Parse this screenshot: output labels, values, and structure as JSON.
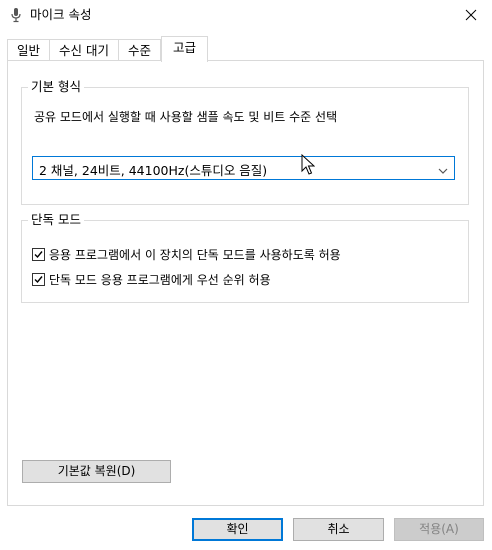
{
  "window": {
    "title": "마이크 속성",
    "title_icon": "microphone-icon",
    "close_icon": "close-icon"
  },
  "tabs": [
    {
      "label": "일반",
      "active": false
    },
    {
      "label": "수신 대기",
      "active": false
    },
    {
      "label": "수준",
      "active": false
    },
    {
      "label": "고급",
      "active": true
    }
  ],
  "default_format": {
    "legend": "기본 형식",
    "description": "공유 모드에서 실행할 때 사용할 샘플 속도 및 비트 수준 선택",
    "selected_value": "2 채널, 24비트, 44100Hz(스튜디오 음질)",
    "arrow_icon": "chevron-down-icon"
  },
  "exclusive_mode": {
    "legend": "단독 모드",
    "options": [
      {
        "label": "응용 프로그램에서 이 장치의 단독 모드를 사용하도록 허용",
        "checked": true
      },
      {
        "label": "단독 모드 응용 프로그램에게 우선 순위 허용",
        "checked": true
      }
    ]
  },
  "buttons": {
    "restore_defaults": "기본값 복원(D)",
    "ok": "확인",
    "cancel": "취소",
    "apply": "적용(A)"
  },
  "colors": {
    "accent": "#0078d7",
    "border": "#d9d9d9",
    "button_bg": "#e1e1e1"
  }
}
